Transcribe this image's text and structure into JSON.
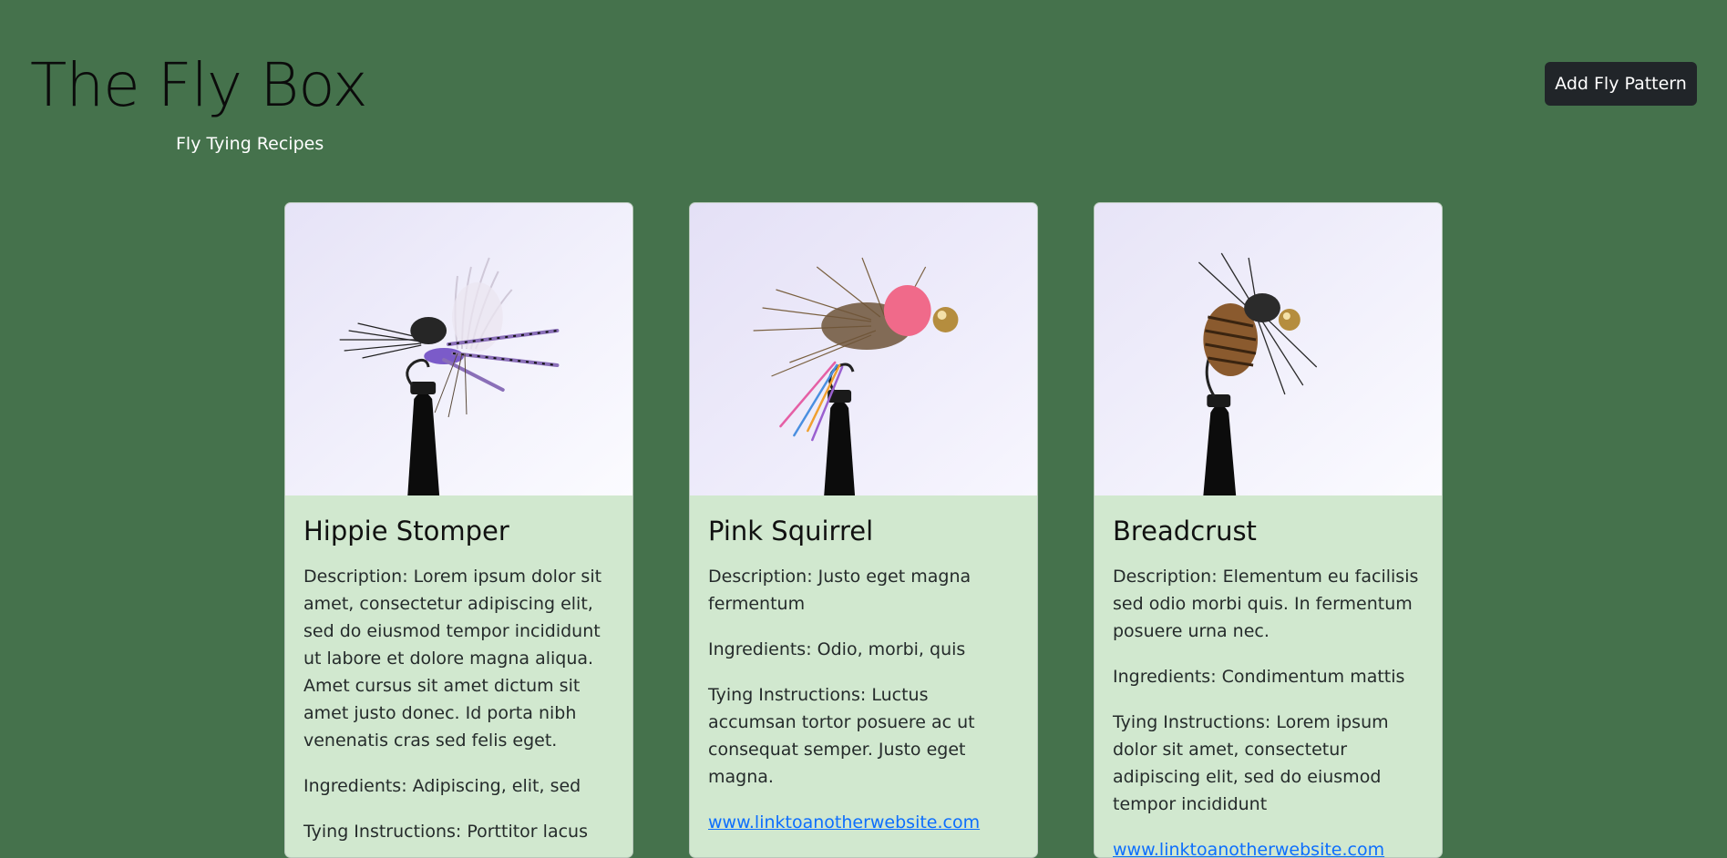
{
  "header": {
    "title": "The Fly Box",
    "subtitle": "Fly Tying Recipes",
    "add_button_label": "Add Fly Pattern"
  },
  "colors": {
    "page_background": "#45724c",
    "card_background": "#d1e8cf",
    "button_background": "#212529",
    "link": "#0d6efd"
  },
  "cards": [
    {
      "title": "Hippie Stomper",
      "description": "Description: Lorem ipsum dolor sit amet, consectetur adipiscing elit, sed do eiusmod tempor incididunt ut labore et dolore magna aliqua. Amet cursus sit amet dictum sit amet justo donec. Id porta nibh venenatis cras sed felis eget.",
      "ingredients": "Ingredients: Adipiscing, elit, sed",
      "instructions": "Tying Instructions: Porttitor lacus",
      "image": "hippie-stomper-fly-photo"
    },
    {
      "title": "Pink Squirrel",
      "description": "Description: Justo eget magna fermentum",
      "ingredients": "Ingredients: Odio, morbi, quis",
      "instructions": "Tying Instructions: Luctus accumsan tortor posuere ac ut consequat semper. Justo eget magna.",
      "link": "www.linktoanotherwebsite.com",
      "image": "pink-squirrel-fly-photo"
    },
    {
      "title": "Breadcrust",
      "description": "Description: Elementum eu facilisis sed odio morbi quis. In fermentum posuere urna nec.",
      "ingredients": "Ingredients: Condimentum mattis",
      "instructions": "Tying Instructions: Lorem ipsum dolor sit amet, consectetur adipiscing elit, sed do eiusmod tempor incididunt",
      "link": "www.linktoanotherwebsite.com",
      "image": "breadcrust-fly-photo"
    }
  ]
}
